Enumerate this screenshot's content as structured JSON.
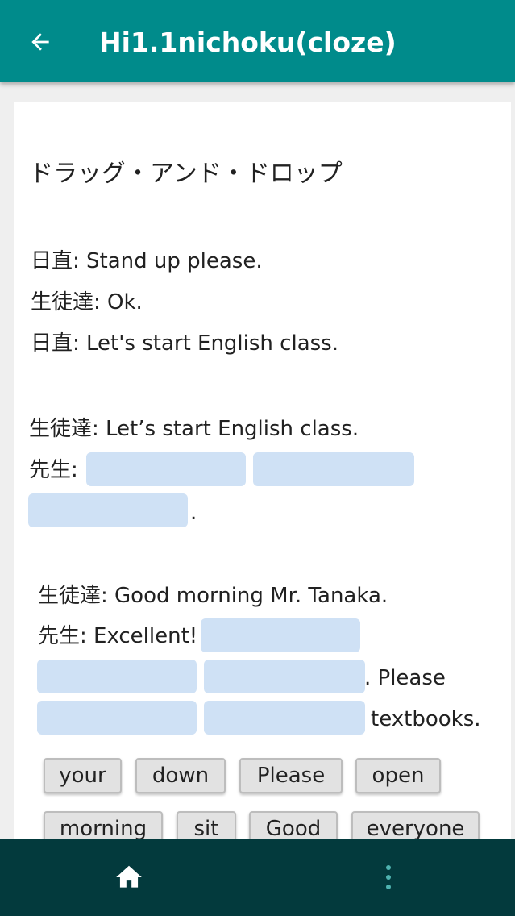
{
  "app_bar": {
    "title": "Hi1.1nichoku(cloze)"
  },
  "content": {
    "heading": "ドラッグ・アンド・ドロップ",
    "lines": [
      "日直: Stand up please.",
      "生徒達: Ok.",
      "日直: Let's start English class.",
      "生徒達: Let’s start English class.",
      "先生:",
      ".",
      "生徒達: Good morning Mr. Tanaka.",
      "先生: Excellent!",
      ". Please",
      "textbooks."
    ]
  },
  "word_bank": [
    "your",
    "down",
    "Please",
    "open",
    "morning",
    "sit",
    "Good",
    "everyone"
  ],
  "colors": {
    "app_bar": "#008b8b",
    "nav_bar": "#033a3d",
    "blank_slot": "#cfe1f5",
    "nav_icon_home": "#ffffff",
    "nav_icon_menu": "#4fb3b0"
  },
  "icons": {
    "back": "arrow-left-icon",
    "home": "home-icon",
    "menu": "more-vert-icon"
  }
}
